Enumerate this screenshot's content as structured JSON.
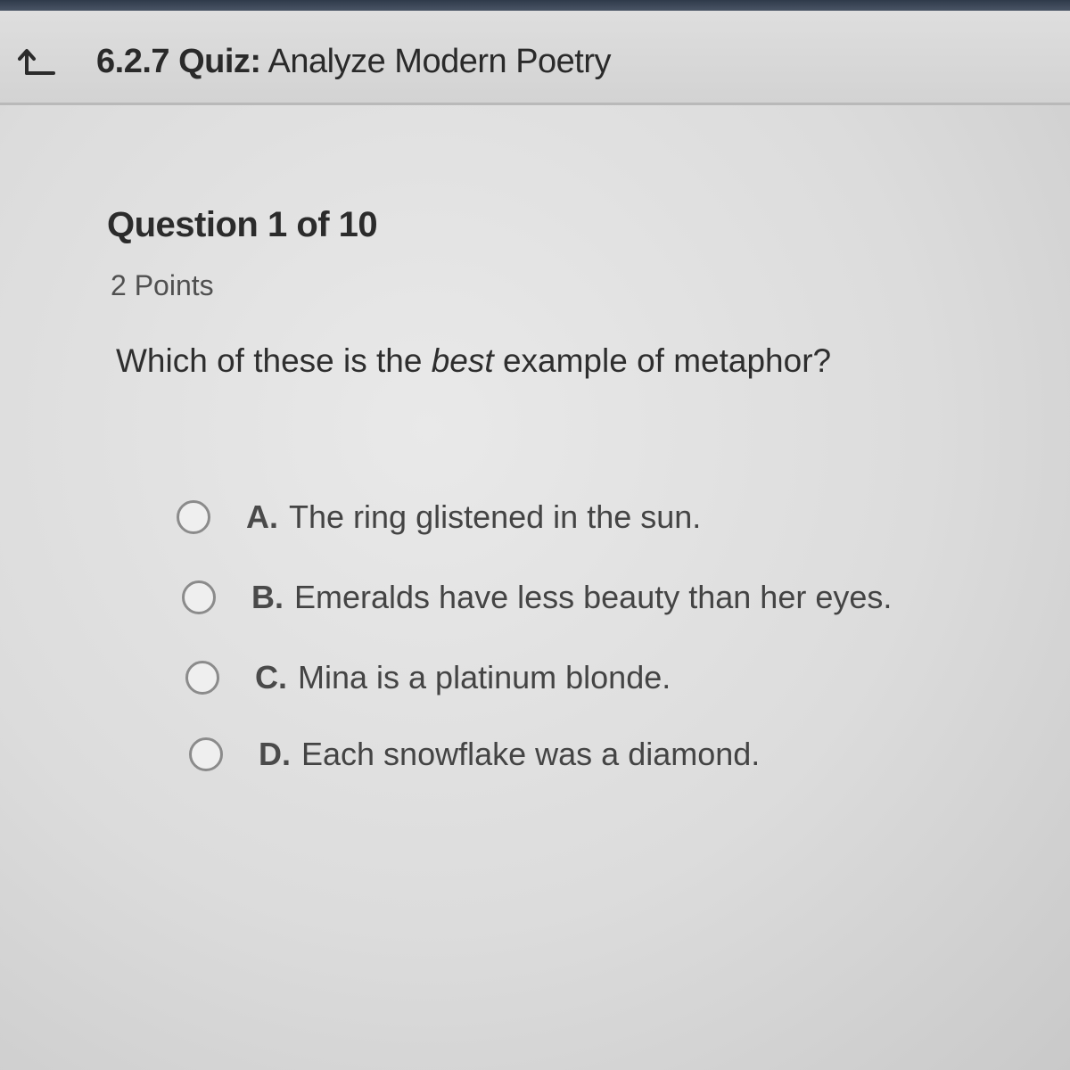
{
  "header": {
    "quiz_code": "6.2.7",
    "quiz_kind": "Quiz:",
    "quiz_name": "Analyze Modern Poetry",
    "back_icon": "back-arrow-icon"
  },
  "question": {
    "title": "Question 1 of 10",
    "points": "2 Points",
    "prompt_before": "Which of these is the ",
    "prompt_emphasis": "best",
    "prompt_after": " example of metaphor?"
  },
  "options": [
    {
      "letter": "A.",
      "text": "The ring glistened in the sun.",
      "selected": false
    },
    {
      "letter": "B.",
      "text": "Emeralds have less beauty than her eyes.",
      "selected": false
    },
    {
      "letter": "C.",
      "text": "Mina is a platinum blonde.",
      "selected": false
    },
    {
      "letter": "D.",
      "text": "Each snowflake was a diamond.",
      "selected": false
    }
  ]
}
